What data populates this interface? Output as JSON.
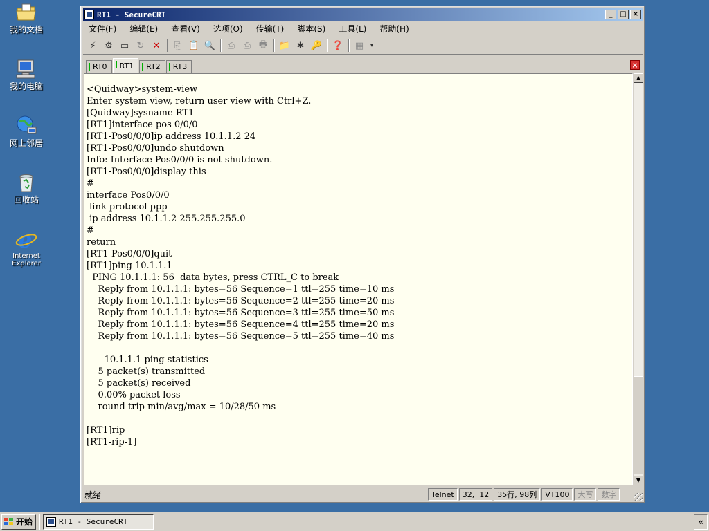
{
  "desktop": {
    "icons": [
      {
        "label": "我的文档",
        "icon": "folder-documents-icon"
      },
      {
        "label": "我的电脑",
        "icon": "computer-icon"
      },
      {
        "label": "网上邻居",
        "icon": "network-icon"
      },
      {
        "label": "回收站",
        "icon": "recycle-bin-icon"
      },
      {
        "label_line1": "Internet",
        "label_line2": "Explorer",
        "icon": "internet-explorer-icon"
      }
    ]
  },
  "window": {
    "title": "RT1 - SecureCRT",
    "controls": {
      "minimize": "_",
      "maximize": "□",
      "close": "×"
    }
  },
  "menu": {
    "items": [
      "文件(F)",
      "编辑(E)",
      "查看(V)",
      "选项(O)",
      "传输(T)",
      "脚本(S)",
      "工具(L)",
      "帮助(H)"
    ]
  },
  "tabs": {
    "items": [
      "RT0",
      "RT1",
      "RT2",
      "RT3"
    ],
    "active": "RT1",
    "close": "×"
  },
  "terminal": {
    "lines": [
      "<Quidway>system-view",
      "Enter system view, return user view with Ctrl+Z.",
      "[Quidway]sysname RT1",
      "[RT1]interface pos 0/0/0",
      "[RT1-Pos0/0/0]ip address 10.1.1.2 24",
      "[RT1-Pos0/0/0]undo shutdown",
      "Info: Interface Pos0/0/0 is not shutdown.",
      "[RT1-Pos0/0/0]display this",
      "#",
      "interface Pos0/0/0",
      " link-protocol ppp",
      " ip address 10.1.1.2 255.255.255.0",
      "#",
      "return",
      "[RT1-Pos0/0/0]quit",
      "[RT1]ping 10.1.1.1",
      "  PING 10.1.1.1: 56  data bytes, press CTRL_C to break",
      "    Reply from 10.1.1.1: bytes=56 Sequence=1 ttl=255 time=10 ms",
      "    Reply from 10.1.1.1: bytes=56 Sequence=2 ttl=255 time=20 ms",
      "    Reply from 10.1.1.1: bytes=56 Sequence=3 ttl=255 time=50 ms",
      "    Reply from 10.1.1.1: bytes=56 Sequence=4 ttl=255 time=20 ms",
      "    Reply from 10.1.1.1: bytes=56 Sequence=5 ttl=255 time=40 ms",
      "",
      "  --- 10.1.1.1 ping statistics ---",
      "    5 packet(s) transmitted",
      "    5 packet(s) received",
      "    0.00% packet loss",
      "    round-trip min/avg/max = 10/28/50 ms",
      "",
      "[RT1]rip",
      "[RT1-rip-1]"
    ]
  },
  "status": {
    "ready": "就绪",
    "protocol": "Telnet",
    "cursor": "32,  12",
    "size": "35行, 98列",
    "emulation": "VT100",
    "caps": "大写",
    "num": "数字"
  },
  "taskbar": {
    "start": "开始",
    "task": "RT1 - SecureCRT",
    "tray_toggle": "«"
  },
  "colors": {
    "desktop": "#3a6ea5",
    "title_start": "#0a246a",
    "title_end": "#a6caf0",
    "terminal_bg": "#fffff0"
  }
}
